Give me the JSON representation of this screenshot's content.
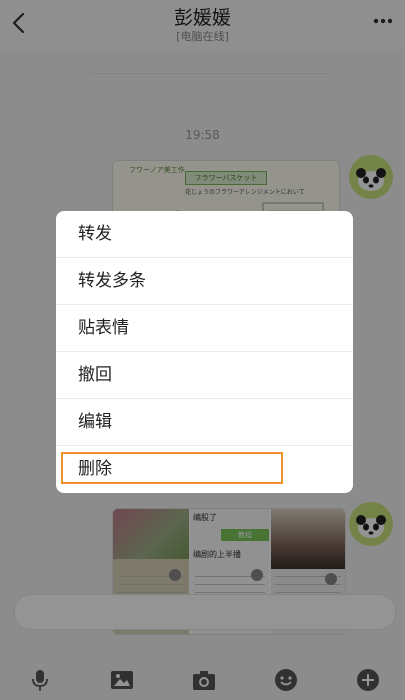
{
  "header": {
    "title": "彭媛媛",
    "subtitle": "[电脑在线]"
  },
  "chat": {
    "timestamp": "19:58",
    "image1": {
      "corner_text": "フワーノア美工作",
      "label": "フラワーバスケット",
      "sub": "花じょうのフラワーアレンジメントにおいて"
    },
    "image2": {
      "panel_title": "编股了",
      "green_label": "教程",
      "panel_sub": "编剧的上半播"
    }
  },
  "menu": {
    "items": [
      {
        "label": "转发"
      },
      {
        "label": "转发多条"
      },
      {
        "label": "贴表情"
      },
      {
        "label": "撤回"
      },
      {
        "label": "编辑"
      },
      {
        "label": "删除"
      }
    ],
    "highlight_color": "#f0912c"
  },
  "toolbar": {
    "icons": [
      "microphone-icon",
      "image-icon",
      "camera-icon",
      "emoji-icon",
      "plus-icon"
    ]
  }
}
